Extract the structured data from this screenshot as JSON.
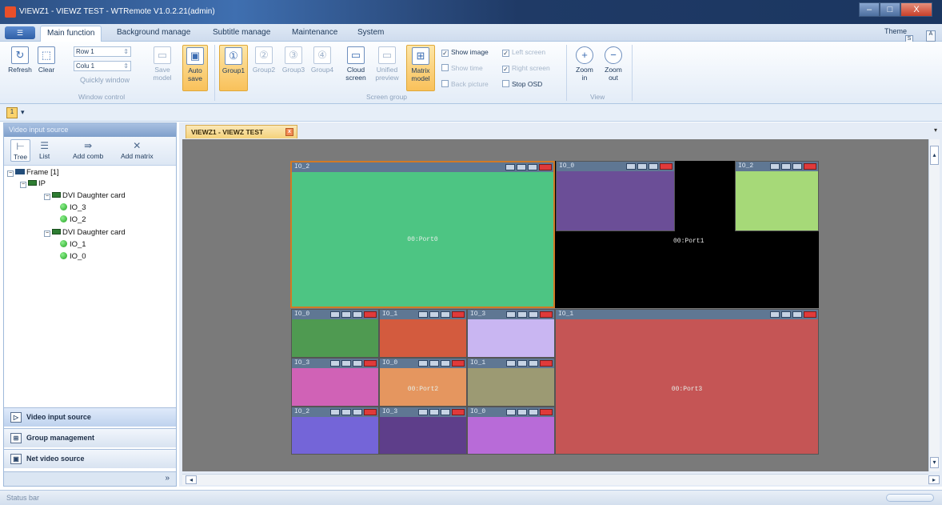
{
  "window": {
    "title": "VIEWZ1 - VIEWZ TEST - WTRemote V1.0.2.21(admin)",
    "controls": [
      "–",
      "□",
      "X"
    ]
  },
  "tabs": [
    {
      "label": "Main function",
      "active": true
    },
    {
      "label": "Background manage",
      "active": false
    },
    {
      "label": "Subtitle manage",
      "active": false
    },
    {
      "label": "Maintenance",
      "active": false
    },
    {
      "label": "System",
      "active": false
    }
  ],
  "theme": {
    "label": "Theme",
    "style_letter": "S",
    "help_letter": "A"
  },
  "ribbon": {
    "refresh": "Refresh",
    "clear": "Clear",
    "row_value": "Row 1",
    "colu_value": "Colu 1",
    "quickly_window": "Quickly window",
    "save_model": "Save model",
    "auto_save": "Auto save",
    "window_control": "Window control",
    "groups": [
      "Group1",
      "Group2",
      "Group3",
      "Group4"
    ],
    "cloud_screen": "Cloud screen",
    "unified_preview": "Unified preview",
    "matrix_model": "Matrix model",
    "show_image": "Show image",
    "show_time": "Show time",
    "back_picture": "Back picture",
    "left_screen": "Left screen",
    "right_screen": "Right screen",
    "stop_osd": "Stop OSD",
    "screen_group": "Screen group",
    "zoom_in": "Zoom in",
    "zoom_out": "Zoom out",
    "view": "View"
  },
  "qat": {
    "icon_text": "1",
    "arrow": "▾"
  },
  "left_panel": {
    "title": "Video input source",
    "toolbar": [
      "Tree",
      "List",
      "Add comb",
      "Add matrix"
    ],
    "tree": {
      "frame": "Frame [1]",
      "ip": "IP",
      "card1": "DVI Daughter card",
      "card1_items": [
        "IO_3",
        "IO_2"
      ],
      "card2": "DVI Daughter card",
      "card2_items": [
        "IO_1",
        "IO_0"
      ]
    },
    "nav": [
      "Video input source",
      "Group management",
      "Net video source"
    ],
    "more": "»"
  },
  "document": {
    "tab": "VIEWZ1 - VIEWZ TEST",
    "close": "x",
    "dropdown": "▾",
    "scroll_left": "◂",
    "scroll_right": "▸",
    "scroll_up": "▴",
    "scroll_down": "▾"
  },
  "canvas": {
    "windows": [
      {
        "title": "IO_2",
        "label": "00:Port0",
        "color": "#4dc583"
      },
      {
        "title": "IO_0",
        "label": "",
        "color": "#6b4e97"
      },
      {
        "title": "IO_2",
        "label": "",
        "color": "#a6d978"
      },
      {
        "title": "IO_0",
        "label": "",
        "color": "#4f9a51"
      },
      {
        "title": "IO_1",
        "label": "",
        "color": "#d35b3e"
      },
      {
        "title": "IO_3",
        "label": "",
        "color": "#c9b6f2"
      },
      {
        "title": "IO_1",
        "label": "00:Port3",
        "color": "#c55555"
      },
      {
        "title": "IO_3",
        "label": "",
        "color": "#d062b6"
      },
      {
        "title": "IO_0",
        "label": "00:Port2",
        "color": "#e5965f"
      },
      {
        "title": "IO_1",
        "label": "",
        "color": "#9c9a73"
      },
      {
        "title": "IO_2",
        "label": "",
        "color": "#7465d8"
      },
      {
        "title": "IO_3",
        "label": "",
        "color": "#5e3e8a"
      },
      {
        "title": "IO_0",
        "label": "",
        "color": "#b86bd8"
      }
    ],
    "port1_label": "00:Port1"
  },
  "status": {
    "text": "Status bar"
  }
}
